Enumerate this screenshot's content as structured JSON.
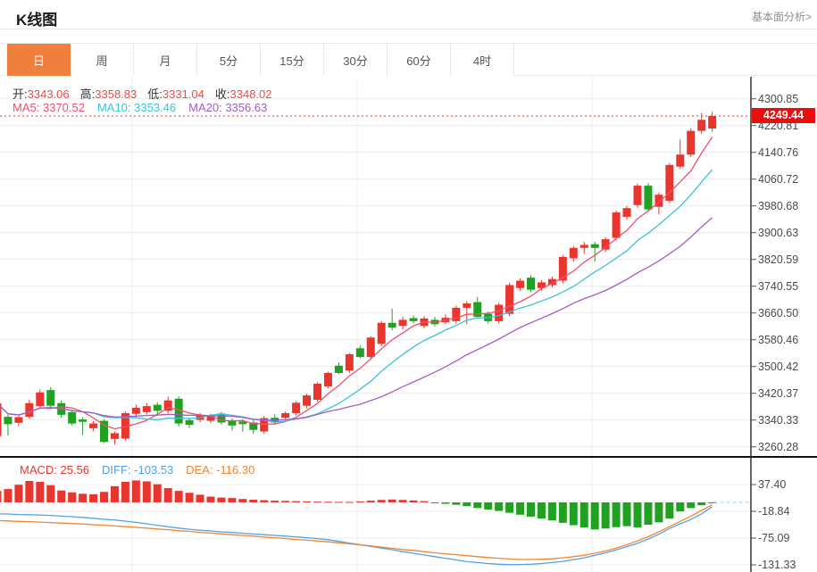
{
  "header": {
    "title": "K线图",
    "link_label": "基本面分析>"
  },
  "tabs": {
    "items": [
      "日",
      "周",
      "月",
      "5分",
      "15分",
      "30分",
      "60分",
      "4时"
    ],
    "active_index": 0
  },
  "info_bar": {
    "ohlc": [
      {
        "label": "开:",
        "value": "3343.06"
      },
      {
        "label": "高:",
        "value": "3358.83"
      },
      {
        "label": "低:",
        "value": "3331.04"
      },
      {
        "label": "收:",
        "value": "3348.02"
      }
    ],
    "ma": [
      {
        "label": "MA5:",
        "value": "3370.52",
        "color": "#ef4f71"
      },
      {
        "label": "MA10:",
        "value": "3353.46",
        "color": "#3cc3da"
      },
      {
        "label": "MA20:",
        "value": "3356.63",
        "color": "#a35cc5"
      }
    ]
  },
  "macd_bar": [
    {
      "label": "MACD:",
      "value": "25.56",
      "color": "#e8352e"
    },
    {
      "label": "DIFF:",
      "value": "-103.53",
      "color": "#55a1e0"
    },
    {
      "label": "DEA:",
      "value": "-116.30",
      "color": "#ee8633"
    }
  ],
  "price_axis": {
    "labels": [
      "4300.85",
      "4220.81",
      "4140.76",
      "4060.72",
      "3980.68",
      "3900.63",
      "3820.59",
      "3740.55",
      "3660.50",
      "3580.46",
      "3500.42",
      "3420.37",
      "3340.33",
      "3260.28"
    ],
    "current": "4249.44"
  },
  "macd_axis": {
    "labels": [
      "37.40",
      "-18.84",
      "-75.09",
      "-131.33"
    ]
  },
  "colors": {
    "up": "#e8352e",
    "down": "#21a121",
    "ma5": "#ef4f71",
    "ma10": "#3cc3da",
    "ma20": "#a35cc5",
    "diff": "#55a1e0",
    "dea": "#ee8633",
    "dotted_line": "#f23030",
    "dashed_zero": "#a8d4f2",
    "grid": "#ececec",
    "axis": "#333333",
    "separator": "#111111",
    "badge_bg": "#ec0d0d",
    "tab_active_bg": "#ef7f3d",
    "ohlc_value": "#ef4a45",
    "tick": "#555555"
  },
  "chart_data": {
    "type": "candlestick",
    "title": "K线图 (日)",
    "y_axis": {
      "ticks": [
        4300.85,
        4220.81,
        4140.76,
        4060.72,
        3980.68,
        3900.63,
        3820.59,
        3740.55,
        3660.5,
        3580.46,
        3500.42,
        3420.37,
        3340.33,
        3260.28
      ]
    },
    "current_price": 4249.44,
    "ma_periods": [
      5,
      10,
      20
    ],
    "candles": [
      [
        3292,
        3395,
        3285,
        3390
      ],
      [
        3350,
        3356,
        3294,
        3328
      ],
      [
        3332,
        3354,
        3322,
        3349
      ],
      [
        3350,
        3401,
        3344,
        3391
      ],
      [
        3382,
        3432,
        3375,
        3423
      ],
      [
        3430,
        3439,
        3377,
        3383
      ],
      [
        3391,
        3399,
        3347,
        3356
      ],
      [
        3364,
        3371,
        3324,
        3330
      ],
      [
        3342,
        3349,
        3296,
        3335
      ],
      [
        3316,
        3337,
        3307,
        3330
      ],
      [
        3338,
        3343,
        3271,
        3275
      ],
      [
        3284,
        3306,
        3267,
        3301
      ],
      [
        3285,
        3366,
        3279,
        3361
      ],
      [
        3359,
        3386,
        3349,
        3377
      ],
      [
        3364,
        3391,
        3357,
        3382
      ],
      [
        3386,
        3393,
        3359,
        3368
      ],
      [
        3368,
        3410,
        3361,
        3399
      ],
      [
        3404,
        3411,
        3321,
        3330
      ],
      [
        3340,
        3347,
        3317,
        3326
      ],
      [
        3341,
        3361,
        3334,
        3355
      ],
      [
        3338,
        3359,
        3331,
        3352
      ],
      [
        3360,
        3365,
        3327,
        3333
      ],
      [
        3338,
        3345,
        3309,
        3324
      ],
      [
        3336,
        3343,
        3305,
        3328
      ],
      [
        3333,
        3341,
        3299,
        3311
      ],
      [
        3306,
        3353,
        3299,
        3346
      ],
      [
        3347,
        3357,
        3329,
        3333
      ],
      [
        3347,
        3366,
        3339,
        3361
      ],
      [
        3361,
        3397,
        3354,
        3392
      ],
      [
        3383,
        3419,
        3375,
        3414
      ],
      [
        3401,
        3453,
        3395,
        3449
      ],
      [
        3441,
        3485,
        3435,
        3481
      ],
      [
        3503,
        3513,
        3477,
        3481
      ],
      [
        3488,
        3541,
        3481,
        3537
      ],
      [
        3555,
        3563,
        3525,
        3529
      ],
      [
        3529,
        3591,
        3523,
        3587
      ],
      [
        3568,
        3637,
        3561,
        3631
      ],
      [
        3631,
        3673,
        3609,
        3617
      ],
      [
        3622,
        3649,
        3611,
        3640
      ],
      [
        3645,
        3653,
        3629,
        3636
      ],
      [
        3622,
        3651,
        3615,
        3644
      ],
      [
        3640,
        3649,
        3621,
        3627
      ],
      [
        3633,
        3656,
        3627,
        3646
      ],
      [
        3636,
        3683,
        3629,
        3676
      ],
      [
        3676,
        3696,
        3627,
        3689
      ],
      [
        3693,
        3708,
        3643,
        3649
      ],
      [
        3658,
        3665,
        3629,
        3636
      ],
      [
        3636,
        3691,
        3629,
        3685
      ],
      [
        3658,
        3751,
        3651,
        3744
      ],
      [
        3735,
        3764,
        3727,
        3757
      ],
      [
        3766,
        3773,
        3723,
        3730
      ],
      [
        3735,
        3759,
        3727,
        3752
      ],
      [
        3744,
        3769,
        3737,
        3762
      ],
      [
        3757,
        3833,
        3749,
        3828
      ],
      [
        3824,
        3861,
        3815,
        3855
      ],
      [
        3855,
        3873,
        3837,
        3864
      ],
      [
        3866,
        3873,
        3814,
        3855
      ],
      [
        3850,
        3887,
        3843,
        3881
      ],
      [
        3885,
        3967,
        3877,
        3961
      ],
      [
        3948,
        3981,
        3939,
        3974
      ],
      [
        3983,
        4047,
        3975,
        4041
      ],
      [
        4041,
        4049,
        3963,
        3970
      ],
      [
        3978,
        4021,
        3955,
        4014
      ],
      [
        3996,
        4109,
        3989,
        4103
      ],
      [
        4098,
        4179,
        4091,
        4134
      ],
      [
        4134,
        4213,
        4127,
        4205
      ],
      [
        4205,
        4258,
        4196,
        4238
      ],
      [
        4212,
        4262,
        4202,
        4249.44
      ]
    ],
    "macd": {
      "ticks": [
        37.4,
        -18.84,
        -75.09,
        -131.33
      ],
      "hist": [
        24,
        28,
        37,
        45,
        43,
        36,
        25,
        21,
        18,
        17,
        22,
        34,
        43,
        46,
        44,
        38,
        30,
        24,
        20,
        16,
        12,
        10,
        9,
        7,
        5.5,
        4.5,
        3.5,
        3,
        2.5,
        2,
        1.5,
        1.2,
        1,
        0.8,
        2,
        3.5,
        5,
        6,
        5,
        4,
        2.5,
        -1.5,
        -3,
        -5,
        -8,
        -12,
        -15,
        -18,
        -22,
        -26,
        -30,
        -34,
        -38,
        -43,
        -48,
        -53,
        -57,
        -55,
        -52,
        -50,
        -53,
        -47,
        -42,
        -34,
        -19,
        -12,
        -6,
        -2
      ],
      "diff": [
        -24,
        -24.5,
        -25.5,
        -26,
        -26.5,
        -27.5,
        -29,
        -30,
        -31.5,
        -33.5,
        -35.5,
        -37,
        -39.5,
        -42,
        -45,
        -48,
        -51.5,
        -54,
        -56.5,
        -58.5,
        -60,
        -62,
        -63,
        -65,
        -66.5,
        -68,
        -69.5,
        -71,
        -72.5,
        -74.5,
        -76,
        -78.5,
        -82,
        -85.5,
        -89,
        -92.5,
        -96,
        -99.5,
        -103.5,
        -107,
        -110.5,
        -114,
        -117.5,
        -121,
        -124.5,
        -126.5,
        -128.5,
        -130,
        -131,
        -130.5,
        -130,
        -128.5,
        -126.5,
        -124,
        -120.5,
        -116.5,
        -111.5,
        -106,
        -100,
        -93,
        -86,
        -77,
        -67,
        -55,
        -45,
        -36,
        -24,
        -9
      ],
      "dea": [
        -38,
        -39,
        -40,
        -40.5,
        -41.5,
        -42.5,
        -43.5,
        -44.5,
        -45.5,
        -47,
        -48,
        -49.5,
        -51,
        -52.5,
        -54,
        -56,
        -57.5,
        -59.5,
        -61,
        -63,
        -64.5,
        -66,
        -68,
        -69.5,
        -71,
        -73,
        -74.5,
        -76,
        -78,
        -79.5,
        -81,
        -83,
        -85,
        -87,
        -89.5,
        -91.5,
        -94,
        -96.5,
        -99,
        -101,
        -103.5,
        -106,
        -108,
        -110,
        -112,
        -114,
        -116,
        -117.5,
        -119,
        -120,
        -120,
        -119.5,
        -118.5,
        -116.5,
        -114,
        -111,
        -107,
        -102,
        -96,
        -89,
        -81,
        -72,
        -62,
        -51,
        -40,
        -29,
        -17,
        -5
      ]
    }
  }
}
